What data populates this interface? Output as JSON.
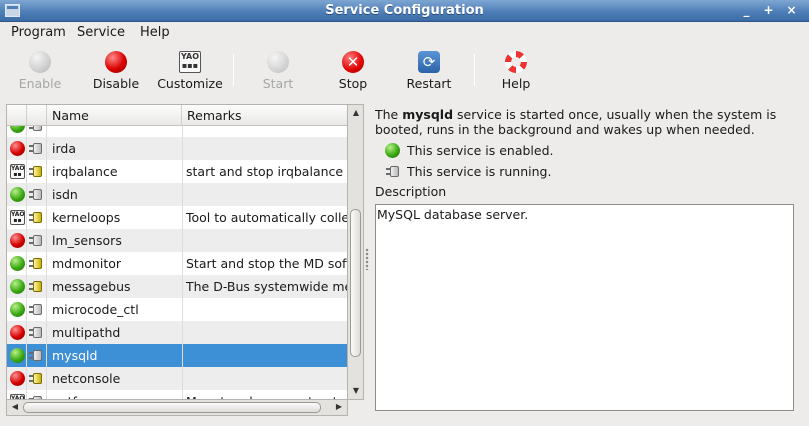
{
  "window": {
    "title": "Service Configuration",
    "controls": [
      "_",
      "+",
      "×"
    ]
  },
  "menubar": {
    "items": [
      "Program",
      "Service",
      "Help"
    ]
  },
  "toolbar": {
    "enable": "Enable",
    "disable": "Disable",
    "customize": "Customize",
    "start": "Start",
    "stop": "Stop",
    "restart": "Restart",
    "help": "Help",
    "customize_icon_text": "YAO\n    "
  },
  "tree": {
    "columns": [
      "Name",
      "Remarks"
    ],
    "rows": [
      {
        "status": "green",
        "running": false,
        "name": "",
        "remarks": "",
        "partial": true
      },
      {
        "status": "red",
        "running": false,
        "name": "irda",
        "remarks": ""
      },
      {
        "status": "custom",
        "running": true,
        "name": "irqbalance",
        "remarks": "start and stop irqbalance d"
      },
      {
        "status": "green",
        "running": false,
        "name": "isdn",
        "remarks": ""
      },
      {
        "status": "custom",
        "running": true,
        "name": "kerneloops",
        "remarks": "Tool to automatically collec"
      },
      {
        "status": "red",
        "running": false,
        "name": "lm_sensors",
        "remarks": ""
      },
      {
        "status": "green",
        "running": true,
        "name": "mdmonitor",
        "remarks": "Start and stop the MD softw"
      },
      {
        "status": "green",
        "running": true,
        "name": "messagebus",
        "remarks": "The D-Bus systemwide me"
      },
      {
        "status": "green",
        "running": false,
        "name": "microcode_ctl",
        "remarks": ""
      },
      {
        "status": "red",
        "running": false,
        "name": "multipathd",
        "remarks": ""
      },
      {
        "status": "green",
        "running": false,
        "name": "mysqld",
        "remarks": "",
        "selected": true
      },
      {
        "status": "red",
        "running": true,
        "name": "netconsole",
        "remarks": ""
      },
      {
        "status": "custom",
        "running": false,
        "name": "netfs",
        "remarks": "Mount and unmount networ",
        "partial": true
      }
    ]
  },
  "details": {
    "intro_prefix": "The ",
    "service_name": "mysqld",
    "intro_suffix": " service is started once, usually when the system is booted, runs in the background and wakes up when needed.",
    "enabled_text": "This service is enabled.",
    "running_text": "This service is running.",
    "description_label": "Description",
    "description": "MySQL database server."
  },
  "colors": {
    "title_bar": "#4f7fb8",
    "selection": "#3d8fd6",
    "enabled_green": "#3aa812",
    "disabled_red": "#d40000"
  }
}
